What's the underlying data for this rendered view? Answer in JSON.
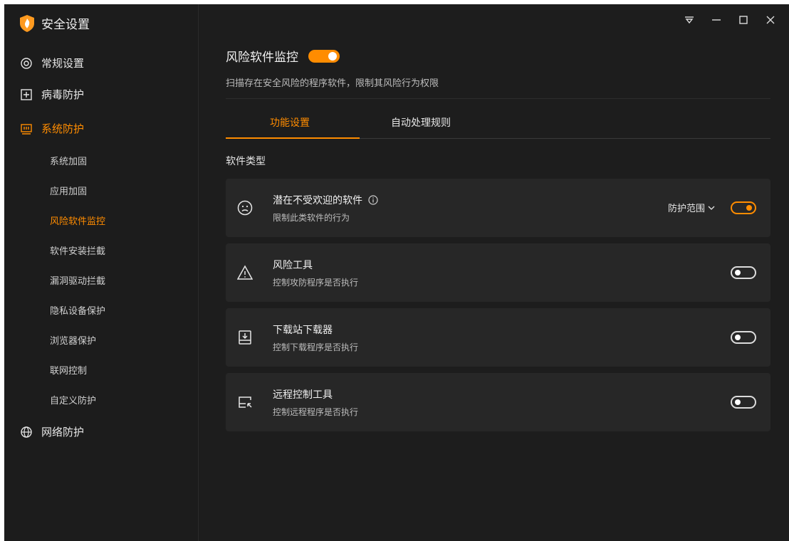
{
  "app": {
    "title": "安全设置"
  },
  "sidebar": {
    "groups": [
      {
        "label": "常规设置",
        "icon": "settings-circle-icon"
      },
      {
        "label": "病毒防护",
        "icon": "plus-box-icon"
      },
      {
        "label": "系统防护",
        "icon": "system-shield-icon",
        "active": true
      },
      {
        "label": "网络防护",
        "icon": "globe-icon"
      }
    ],
    "system_items": [
      {
        "label": "系统加固"
      },
      {
        "label": "应用加固"
      },
      {
        "label": "风险软件监控",
        "active": true
      },
      {
        "label": "软件安装拦截"
      },
      {
        "label": "漏洞驱动拦截"
      },
      {
        "label": "隐私设备保护"
      },
      {
        "label": "浏览器保护"
      },
      {
        "label": "联网控制"
      },
      {
        "label": "自定义防护"
      }
    ]
  },
  "main": {
    "title": "风险软件监控",
    "title_toggle_on": true,
    "description": "扫描存在安全风险的程序软件，限制其风险行为权限",
    "tabs": [
      {
        "label": "功能设置",
        "active": true
      },
      {
        "label": "自动处理规则"
      }
    ],
    "section_title": "软件类型",
    "items": [
      {
        "title": "潜在不受欢迎的软件",
        "desc": "限制此类软件的行为",
        "icon": "sad-face-icon",
        "scope_label": "防护范围",
        "enabled": true
      },
      {
        "title": "风险工具",
        "desc": "控制攻防程序是否执行",
        "icon": "warning-triangle-icon",
        "enabled": false
      },
      {
        "title": "下载站下载器",
        "desc": "控制下载程序是否执行",
        "icon": "download-box-icon",
        "enabled": false
      },
      {
        "title": "远程控制工具",
        "desc": "控制远程程序是否执行",
        "icon": "remote-screen-icon",
        "enabled": false
      }
    ]
  },
  "colors": {
    "accent": "#ff8c00",
    "background": "#1c1c1c",
    "card": "#272727"
  }
}
